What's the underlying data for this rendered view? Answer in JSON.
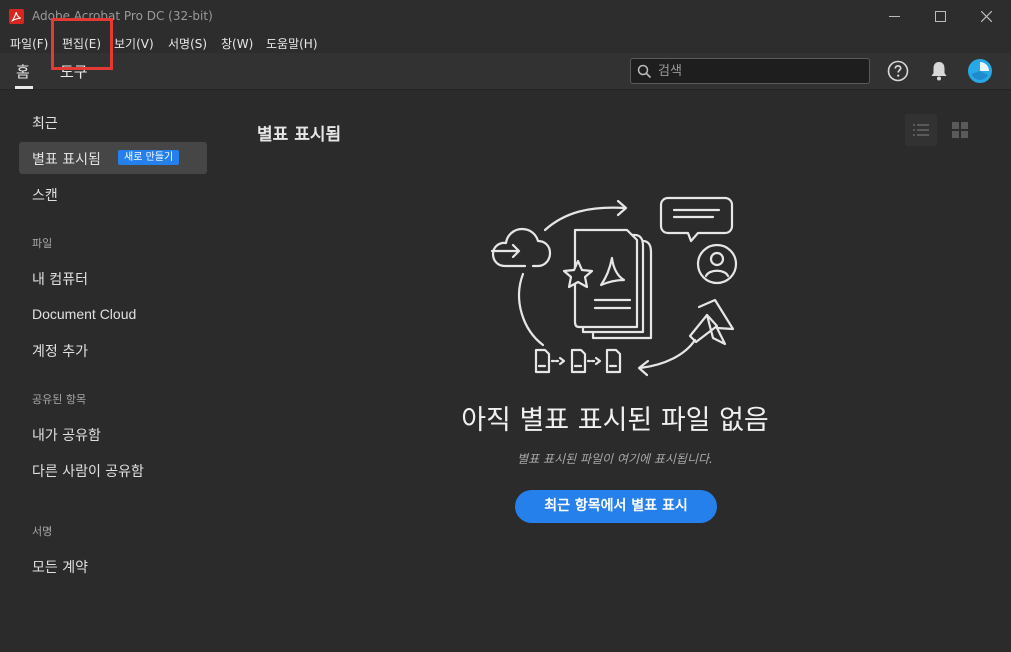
{
  "window": {
    "title": "Adobe Acrobat Pro DC (32-bit)",
    "icon": "acrobat-logo-icon",
    "controls": [
      "minimize-icon",
      "maximize-icon",
      "close-icon"
    ]
  },
  "menubar": {
    "items": [
      "파일(F)",
      "편집(E)",
      "보기(V)",
      "서명(S)",
      "창(W)",
      "도움말(H)"
    ]
  },
  "tabs": [
    {
      "label": "홈",
      "active": true
    },
    {
      "label": "도구",
      "active": false
    }
  ],
  "search": {
    "placeholder": "검색"
  },
  "toolbar_icons": [
    "help-icon",
    "bell-icon",
    "avatar"
  ],
  "sidebar": {
    "recent": "최근",
    "starred": "별표 표시됨",
    "new_badge": "새로 만들기",
    "scan": "스캔",
    "files_header": "파일",
    "my_computer": "내 컴퓨터",
    "document_cloud": "Document Cloud",
    "add_account": "계정 추가",
    "shared_header": "공유된 항목",
    "shared_by_me": "내가 공유함",
    "shared_by_others": "다른 사람이 공유함",
    "sign_header": "서명",
    "all_agreements": "모든 계약"
  },
  "main": {
    "title": "별표 표시됨",
    "empty_title": "아직 별표 표시된 파일 없음",
    "empty_subtitle": "별표 표시된 파일이 여기에 표시됩니다.",
    "cta_label": "최근 항목에서 별표 표시"
  },
  "colors": {
    "accent": "#2680eb",
    "background": "#2b2b2b",
    "highlight": "#e53935"
  }
}
